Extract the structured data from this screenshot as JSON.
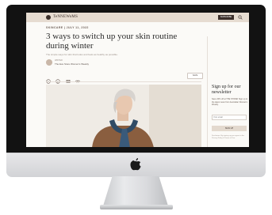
{
  "site": {
    "brand": "TeNNEWoMS",
    "subscribe": "SUBSCRIBE"
  },
  "article": {
    "eyebrow": "SKINCARE  |  JULY 11, 2022",
    "headline": "3 ways to switch up your skin routine during winter",
    "dek": "The simple ways for skin that looks and feels as healthy as possible.",
    "author_role": "WRITER",
    "author_name": "The Eve Store Women's Weekly",
    "save_label": "SAVE"
  },
  "sidebar": {
    "title": "Sign up for our newsletter",
    "description": "Save 20% off at THE STORE! Sign up to the latest news from Australian Woman's Weekly.",
    "email_placeholder": "Your email",
    "button": "SIGN UP",
    "disclaimer": "Disclaimer: By signing up you agree to the Privacy Policy & Terms of Use."
  },
  "colors": {
    "header_bg": "#e6dcd1",
    "brand_dark": "#3b2f2a",
    "page_bg": "#fbfaf7",
    "bezel": "#121212"
  }
}
